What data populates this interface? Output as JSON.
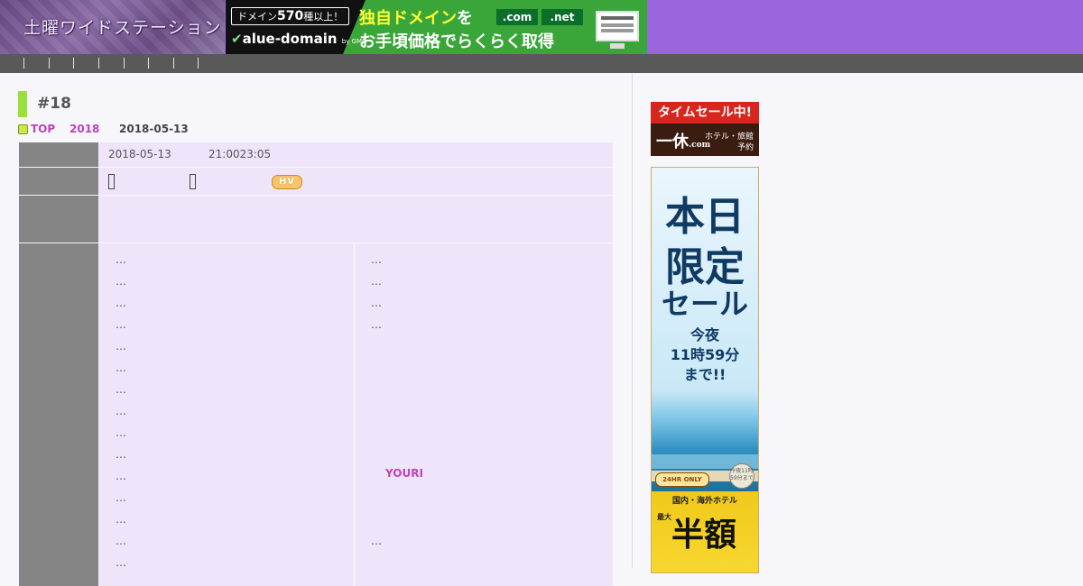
{
  "header": {
    "site_logo_text": "土曜ワイドステーション",
    "ad": {
      "pill_prefix": "ドメイン",
      "pill_count": "570",
      "pill_suffix": "種以上！",
      "brand": "alue-domain",
      "brand_sub": "by GMO",
      "line1": "独自ドメイン",
      "line1_wo": "を",
      "tld1": ".com",
      "tld2": ".net",
      "line2": "お手頃価格でらくらく取得"
    }
  },
  "nav": {
    "separator_count": 8
  },
  "article": {
    "title": "#18",
    "breadcrumb": {
      "top": "TOP",
      "year": "2018",
      "date": "2018-05-13"
    },
    "meta_row": {
      "date": "2018-05-13",
      "time": "21:0023:05"
    },
    "badge": "HV",
    "left_column": [
      "…",
      "…",
      "…",
      "…",
      "…",
      "…",
      "…",
      "…",
      "…",
      "…",
      "…",
      "…",
      "…",
      "…",
      "…"
    ],
    "right_column_top": [
      "…",
      "…",
      "…",
      "…"
    ],
    "right_column_name": "YOURI",
    "right_column_bottom": "…"
  },
  "sidebar": {
    "timesale": {
      "head": "タイムセール中!",
      "brand": "一休",
      "brand_sub": ".com",
      "sub": "ホテル・旅館\n予約"
    },
    "tall_ad": {
      "line1": "本日",
      "line2": "限定",
      "line3": "セール",
      "line4": "今夜",
      "line5": "11時59分",
      "line6": "まで!!",
      "tag": "24HR ONLY",
      "stamp": "今夜11時59分まで",
      "hotel": "国内・海外ホテル",
      "half_small": "最大",
      "half": "半額"
    }
  },
  "colors": {
    "header_bg": "#9966dd",
    "nav_bg": "#595959",
    "accent_green": "#99e03a",
    "link_purple": "#bb44bb",
    "row_head": "#858585",
    "row_cell": "#efe5fb"
  }
}
